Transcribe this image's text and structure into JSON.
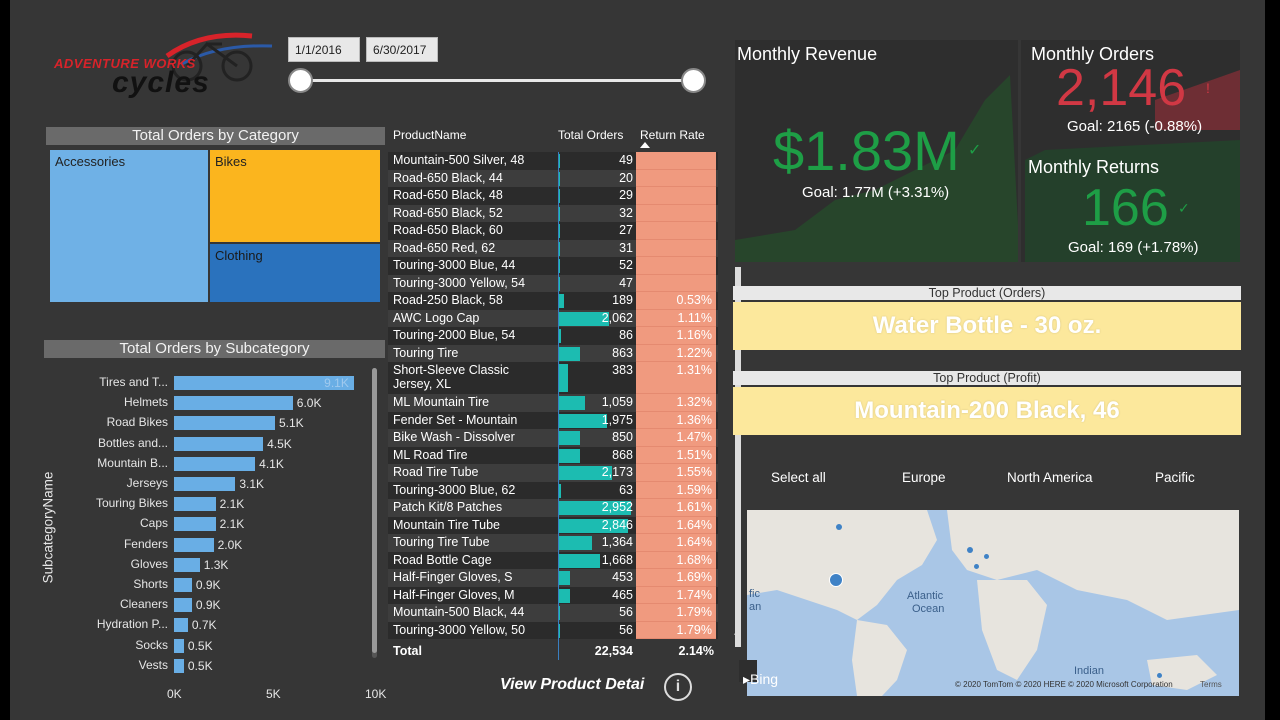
{
  "logo": {
    "line1": "ADVENTURE WORKS",
    "line2": "cycles"
  },
  "date_slicer": {
    "start": "1/1/2016",
    "end": "6/30/2017"
  },
  "category_treemap": {
    "title": "Total Orders by Category",
    "categories": [
      "Accessories",
      "Bikes",
      "Clothing"
    ],
    "colors": {
      "Accessories": "#6fb1e6",
      "Bikes": "#fbb51e",
      "Clothing": "#2a72bd"
    }
  },
  "subcategory_chart": {
    "title": "Total Orders by Subcategory",
    "ylabel": "SubcategoryName",
    "chart_data": {
      "type": "bar",
      "categories": [
        "Tires and T...",
        "Helmets",
        "Road Bikes",
        "Bottles and...",
        "Mountain B...",
        "Jerseys",
        "Touring Bikes",
        "Caps",
        "Fenders",
        "Gloves",
        "Shorts",
        "Cleaners",
        "Hydration P...",
        "Socks",
        "Vests"
      ],
      "values": [
        9100,
        6000,
        5100,
        4500,
        4100,
        3100,
        2100,
        2100,
        2000,
        1300,
        900,
        900,
        700,
        500,
        500
      ],
      "value_labels": [
        "9.1K",
        "6.0K",
        "5.1K",
        "4.5K",
        "4.1K",
        "3.1K",
        "2.1K",
        "2.1K",
        "2.0K",
        "1.3K",
        "0.9K",
        "0.9K",
        "0.7K",
        "0.5K",
        "0.5K"
      ],
      "xticks": [
        "0K",
        "5K",
        "10K"
      ],
      "xlim": [
        0,
        10000
      ],
      "color": "#69aee5"
    }
  },
  "product_table": {
    "headers": {
      "name": "ProductName",
      "orders": "Total Orders",
      "return_rate": "Return Rate"
    },
    "rows": [
      {
        "name": "Mountain-500 Silver, 48",
        "orders": "49",
        "orders_value": 49,
        "rr": ""
      },
      {
        "name": "Road-650 Black, 44",
        "orders": "20",
        "orders_value": 20,
        "rr": ""
      },
      {
        "name": "Road-650 Black, 48",
        "orders": "29",
        "orders_value": 29,
        "rr": ""
      },
      {
        "name": "Road-650 Black, 52",
        "orders": "32",
        "orders_value": 32,
        "rr": ""
      },
      {
        "name": "Road-650 Black, 60",
        "orders": "27",
        "orders_value": 27,
        "rr": ""
      },
      {
        "name": "Road-650 Red, 62",
        "orders": "31",
        "orders_value": 31,
        "rr": ""
      },
      {
        "name": "Touring-3000 Blue, 44",
        "orders": "52",
        "orders_value": 52,
        "rr": ""
      },
      {
        "name": "Touring-3000 Yellow, 54",
        "orders": "47",
        "orders_value": 47,
        "rr": ""
      },
      {
        "name": "Road-250 Black, 58",
        "orders": "189",
        "orders_value": 189,
        "rr": "0.53%"
      },
      {
        "name": "AWC Logo Cap",
        "orders": "2,062",
        "orders_value": 2062,
        "rr": "1.11%"
      },
      {
        "name": "Touring-2000 Blue, 54",
        "orders": "86",
        "orders_value": 86,
        "rr": "1.16%"
      },
      {
        "name": "Touring Tire",
        "orders": "863",
        "orders_value": 863,
        "rr": "1.22%"
      },
      {
        "name": "Short-Sleeve Classic",
        "name2": "Jersey, XL",
        "orders": "383",
        "orders_value": 383,
        "rr": "1.31%"
      },
      {
        "name": "ML Mountain Tire",
        "orders": "1,059",
        "orders_value": 1059,
        "rr": "1.32%"
      },
      {
        "name": "Fender Set - Mountain",
        "orders": "1,975",
        "orders_value": 1975,
        "rr": "1.36%"
      },
      {
        "name": "Bike Wash - Dissolver",
        "orders": "850",
        "orders_value": 850,
        "rr": "1.47%"
      },
      {
        "name": "ML Road Tire",
        "orders": "868",
        "orders_value": 868,
        "rr": "1.51%"
      },
      {
        "name": "Road Tire Tube",
        "orders": "2,173",
        "orders_value": 2173,
        "rr": "1.55%"
      },
      {
        "name": "Touring-3000 Blue, 62",
        "orders": "63",
        "orders_value": 63,
        "rr": "1.59%"
      },
      {
        "name": "Patch Kit/8 Patches",
        "orders": "2,952",
        "orders_value": 2952,
        "rr": "1.61%"
      },
      {
        "name": "Mountain Tire Tube",
        "orders": "2,846",
        "orders_value": 2846,
        "rr": "1.64%"
      },
      {
        "name": "Touring Tire Tube",
        "orders": "1,364",
        "orders_value": 1364,
        "rr": "1.64%"
      },
      {
        "name": "Road Bottle Cage",
        "orders": "1,668",
        "orders_value": 1668,
        "rr": "1.68%"
      },
      {
        "name": "Half-Finger Gloves, S",
        "orders": "453",
        "orders_value": 453,
        "rr": "1.69%"
      },
      {
        "name": "Half-Finger Gloves, M",
        "orders": "465",
        "orders_value": 465,
        "rr": "1.74%"
      },
      {
        "name": "Mountain-500 Black, 44",
        "orders": "56",
        "orders_value": 56,
        "rr": "1.79%"
      },
      {
        "name": "Touring-3000 Yellow, 50",
        "orders": "56",
        "orders_value": 56,
        "rr": "1.79%"
      }
    ],
    "total": {
      "label": "Total",
      "orders": "22,534",
      "rr": "2.14%"
    },
    "view_detail_label": "View Product Detai"
  },
  "kpi": {
    "revenue": {
      "title": "Monthly Revenue",
      "value": "$1.83M",
      "goal": "Goal: 1.77M (+3.31%)",
      "color": "#1e9e46"
    },
    "orders": {
      "title": "Monthly Orders",
      "value": "2,146",
      "goal": "Goal: 2165 (-0.88%)",
      "color": "#d13844"
    },
    "returns": {
      "title": "Monthly Returns",
      "value": "166",
      "goal": "Goal: 169 (+1.78%)",
      "color": "#1e9e46"
    }
  },
  "top_product": {
    "orders_header": "Top Product (Orders)",
    "orders_value": "Water Bottle - 30 oz.",
    "profit_header": "Top Product (Profit)",
    "profit_value": "Mountain-200 Black, 46"
  },
  "region_slicer": {
    "options": [
      "Select all",
      "Europe",
      "North America",
      "Pacific"
    ]
  },
  "map": {
    "labels": [
      "Atlantic",
      "Ocean",
      "Indian",
      "fic",
      "an"
    ],
    "bing": "Bing",
    "copyright": "© 2020 TomTom © 2020 HERE © 2020 Microsoft Corporation",
    "terms": "Terms"
  }
}
